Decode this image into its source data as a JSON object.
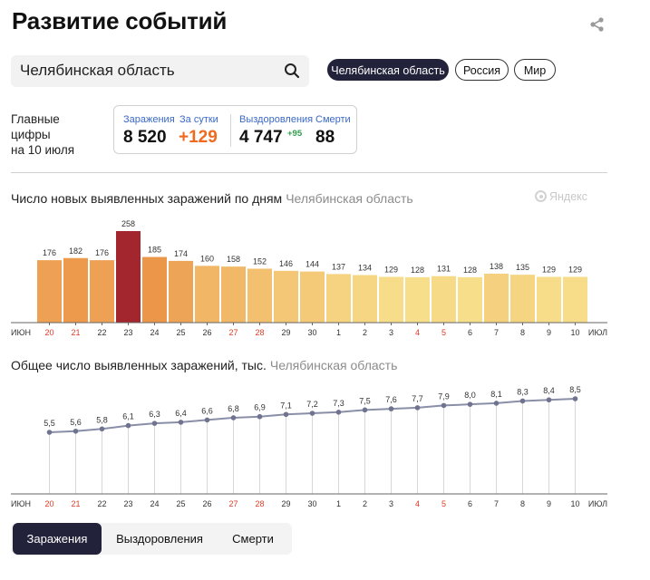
{
  "page": {
    "title": "Развитие событий",
    "search_value": "Челябинская область",
    "regions": [
      "Челябинская область",
      "Россия",
      "Мир"
    ],
    "active_region": "Челябинская область"
  },
  "summary": {
    "label_line1": "Главные цифры",
    "label_line2": "на 10 июля",
    "infections_label": "Заражения",
    "infections_value": "8 520",
    "daily_label": "За сутки",
    "daily_value": "+129",
    "recovered_label": "Выздоровления",
    "recovered_value": "4 747",
    "recovered_delta": "+95",
    "deaths_label": "Смерти",
    "deaths_value": "88"
  },
  "chart1_header": {
    "title": "Число новых выявленных заражений по дням",
    "region": "Челябинская область"
  },
  "chart2_header": {
    "title": "Общее число выявленных заражений, тыс.",
    "region": "Челябинская область"
  },
  "brand": "Яндекс",
  "tabs": [
    "Заражения",
    "Выздоровления",
    "Смерти"
  ],
  "active_tab": "Заражения",
  "colors": {
    "accent_dark": "#22223a",
    "orange_value": "#ef6a1e",
    "green_delta": "#2e9d4b",
    "highlight_bar": "#a3252d",
    "weekend_label": "#e03a26"
  },
  "chart_data": [
    {
      "type": "bar",
      "title": "Число новых выявленных заражений по дням",
      "subtitle": "Челябинская область",
      "categories": [
        "20",
        "21",
        "22",
        "23",
        "24",
        "25",
        "26",
        "27",
        "28",
        "29",
        "30",
        "1",
        "2",
        "3",
        "4",
        "5",
        "6",
        "7",
        "8",
        "9",
        "10"
      ],
      "values": [
        176,
        182,
        176,
        258,
        185,
        174,
        160,
        158,
        152,
        146,
        144,
        137,
        134,
        129,
        128,
        131,
        128,
        138,
        135,
        129,
        129
      ],
      "highlight_index": 3,
      "weekend_categories": [
        "20",
        "21",
        "27",
        "28",
        "4",
        "5"
      ],
      "x_start_label": "ИЮН",
      "x_end_label": "ИЮЛ",
      "grid": false
    },
    {
      "type": "line",
      "title": "Общее число выявленных заражений, тыс.",
      "subtitle": "Челябинская область",
      "categories": [
        "20",
        "21",
        "22",
        "23",
        "24",
        "25",
        "26",
        "27",
        "28",
        "29",
        "30",
        "1",
        "2",
        "3",
        "4",
        "5",
        "6",
        "7",
        "8",
        "9",
        "10"
      ],
      "values": [
        5.5,
        5.6,
        5.8,
        6.1,
        6.3,
        6.4,
        6.6,
        6.8,
        6.9,
        7.1,
        7.2,
        7.3,
        7.5,
        7.6,
        7.7,
        7.9,
        8.0,
        8.1,
        8.3,
        8.4,
        8.5
      ],
      "labels": [
        "5,5",
        "5,6",
        "5,8",
        "6,1",
        "6,3",
        "6,4",
        "6,6",
        "6,8",
        "6,9",
        "7,1",
        "7,2",
        "7,3",
        "7,5",
        "7,6",
        "7,7",
        "7,9",
        "8,0",
        "8,1",
        "8,3",
        "8,4",
        "8,5"
      ],
      "weekend_categories": [
        "20",
        "21",
        "27",
        "28",
        "4",
        "5"
      ],
      "x_start_label": "ИЮН",
      "x_end_label": "ИЮЛ",
      "grid": "vertical"
    }
  ]
}
